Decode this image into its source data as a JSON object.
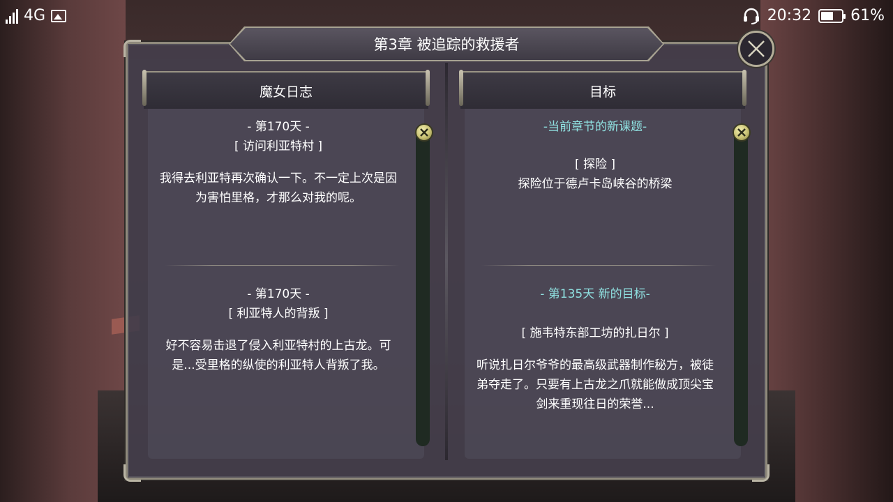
{
  "status_bar": {
    "network": "4G",
    "time": "20:32",
    "battery_percent": "61%",
    "battery_level": 0.61,
    "icons": [
      "signal-icon",
      "gallery-icon",
      "headset-icon",
      "battery-icon"
    ]
  },
  "dialog": {
    "title": "第3章  被追踪的救援者",
    "close_icon": "close-icon"
  },
  "left_panel": {
    "header": "魔女日志",
    "entries": [
      {
        "date": "- 第170天 -",
        "subtitle": "[ 访问利亚特村 ]",
        "text": "我得去利亚特再次确认一下。不一定上次是因为害怕里格，才那么对我的呢。"
      },
      {
        "date": "- 第170天 -",
        "subtitle": "[ 利亚特人的背叛 ]",
        "text": "好不容易击退了侵入利亚特村的上古龙。可是...受里格的纵使的利亚特人背叛了我。"
      }
    ]
  },
  "right_panel": {
    "header": "目标",
    "entries": [
      {
        "date": "-当前章节的新课题-",
        "subtitle": "[ 探险 ]",
        "text": "探险位于德卢卡岛峡谷的桥梁"
      },
      {
        "date": "- 第135天  新的目标-",
        "subtitle": "[ 施韦特东部工坊的扎日尔 ]",
        "text": "听说扎日尔爷爷的最高级武器制作秘方，被徒弟夺走了。只要有上古龙之爪就能做成顶尖宝剑来重现往日的荣誉..."
      }
    ]
  },
  "colors": {
    "accent_teal": "#8fe0e0",
    "scroll_knob": "#c9c274",
    "frame_gold": "#b3ad98"
  }
}
